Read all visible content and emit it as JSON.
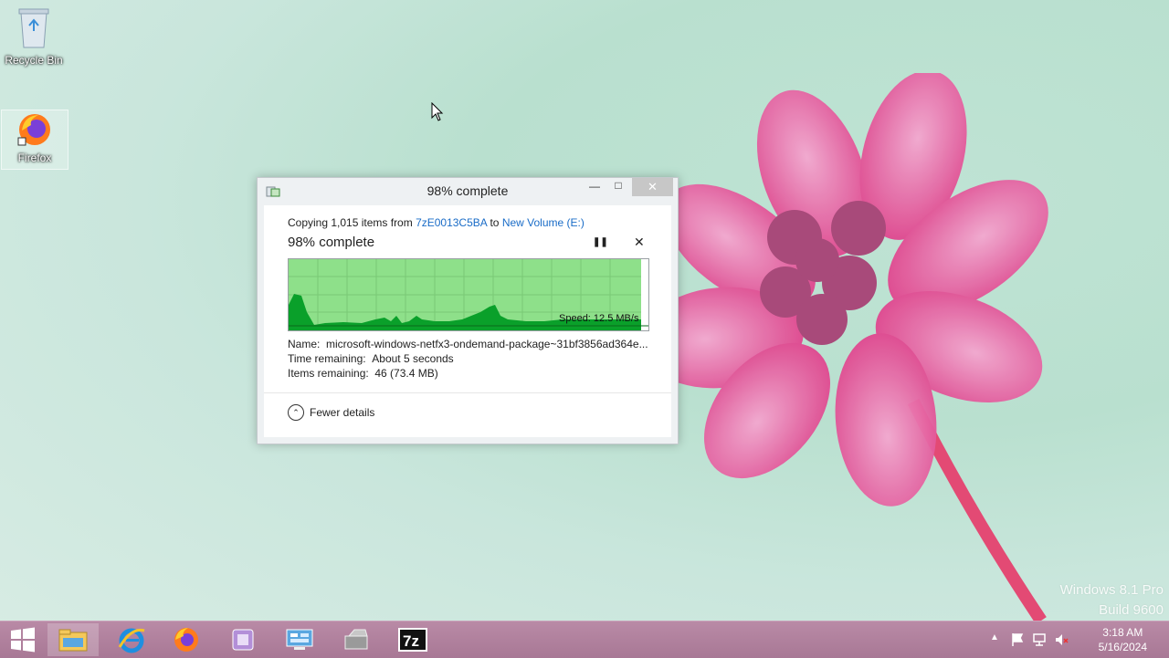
{
  "desktop": {
    "icons": [
      {
        "label": "Recycle Bin",
        "icon": "recycle-bin-icon"
      },
      {
        "label": "Firefox",
        "icon": "firefox-icon"
      }
    ],
    "watermark": {
      "line1": "Windows 8.1 Pro",
      "line2": "Build 9600"
    }
  },
  "dialog": {
    "title": "98% complete",
    "copy_prefix": "Copying 1,015 items from ",
    "source": "7zE0013C5BA",
    "to_word": " to ",
    "destination": "New Volume (E:)",
    "status": "98% complete",
    "progress_fraction": 0.98,
    "speed": "Speed: 12.5 MB/s",
    "name_label": "Name:",
    "name_value": "microsoft-windows-netfx3-ondemand-package~31bf3856ad364e...",
    "time_label": "Time remaining:",
    "time_value": "About 5 seconds",
    "items_label": "Items remaining:",
    "items_value": "46 (73.4 MB)",
    "fewer_details": "Fewer details"
  },
  "taskbar": {
    "items": [
      "start-icon",
      "file-explorer-icon",
      "internet-explorer-icon",
      "firefox-icon",
      "app-icon",
      "control-panel-icon",
      "installer-icon",
      "7zip-icon"
    ],
    "clock_time": "3:18 AM",
    "clock_date": "5/16/2024"
  },
  "colors": {
    "accent": "#1a6cc7",
    "graph_fill": "#0aa02a",
    "graph_bg": "#8ee08a"
  }
}
